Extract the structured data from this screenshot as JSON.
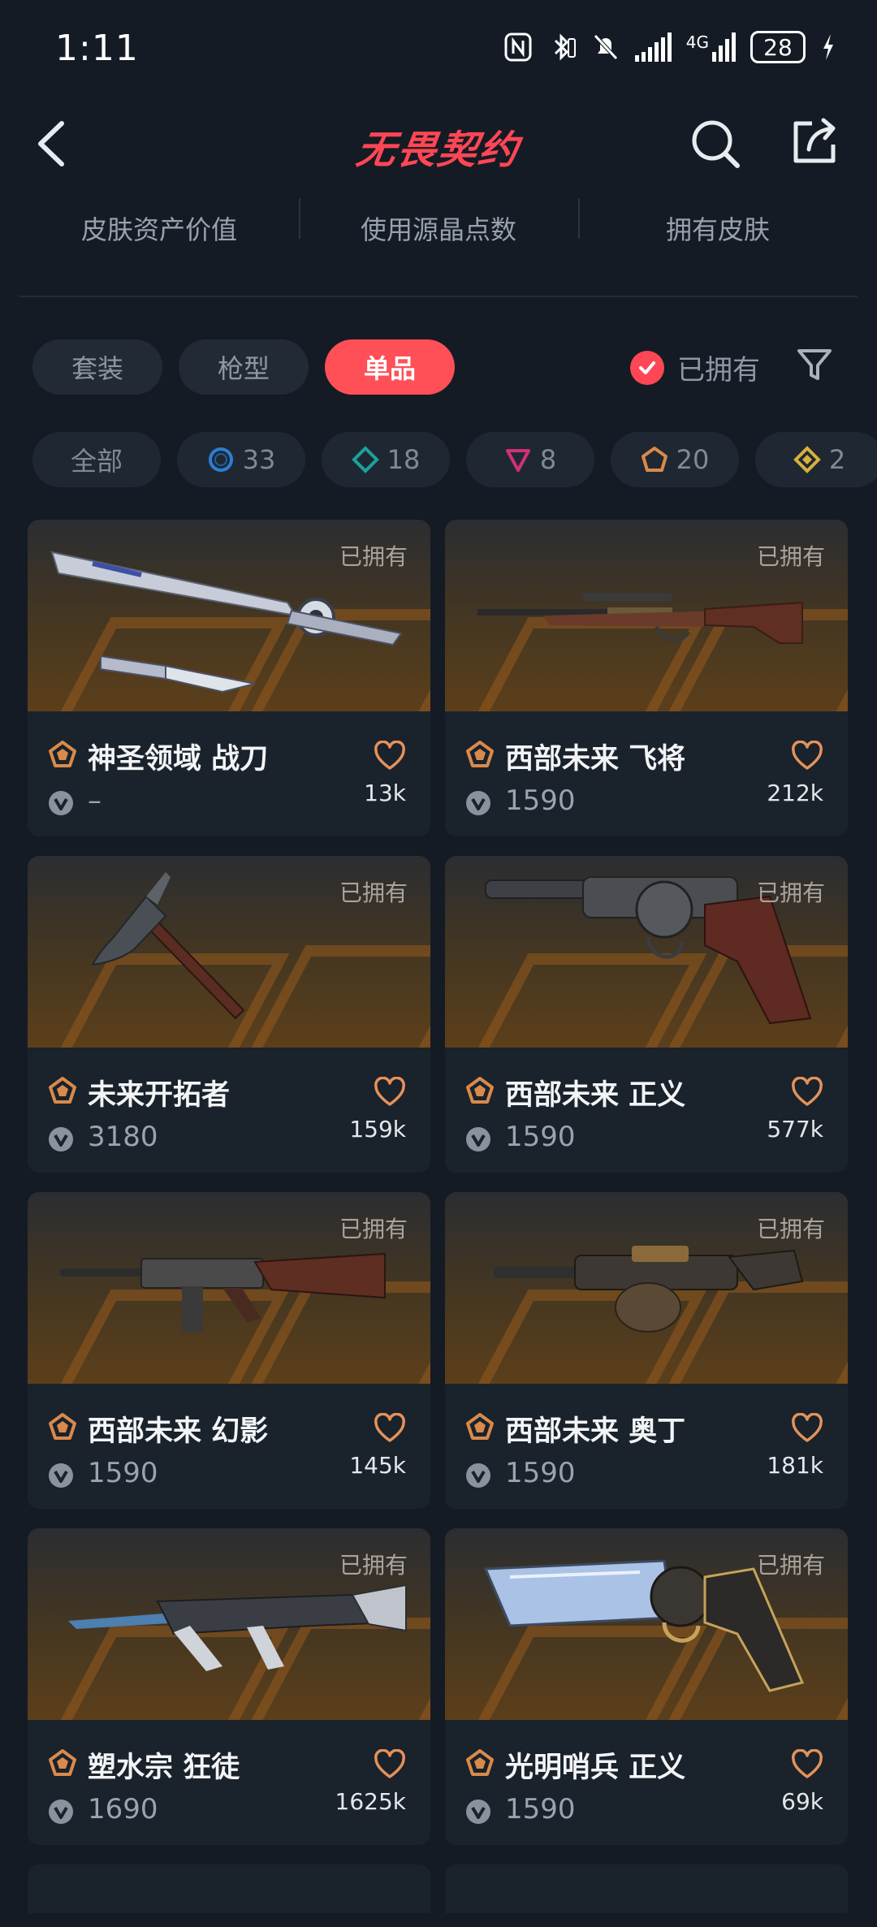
{
  "status_bar": {
    "time": "1:11",
    "network": "4G",
    "battery": "28"
  },
  "header": {
    "logo": "无畏契约",
    "logo_color": "#ff4655"
  },
  "stats": [
    {
      "label": "皮肤资产价值"
    },
    {
      "label": "使用源晶点数"
    },
    {
      "label": "拥有皮肤"
    }
  ],
  "categories": [
    {
      "label": "套装",
      "active": false
    },
    {
      "label": "枪型",
      "active": false
    },
    {
      "label": "单品",
      "active": true
    }
  ],
  "owned_filter": {
    "label": "已拥有",
    "checked": true
  },
  "rarity_filters": [
    {
      "label": "全部",
      "icon": "none"
    },
    {
      "label": "33",
      "icon": "circle-tier-icon",
      "color": "#2b7fd4"
    },
    {
      "label": "18",
      "icon": "diamond-tier-icon",
      "color": "#1aa39a"
    },
    {
      "label": "8",
      "icon": "triangle-tier-icon",
      "color": "#d1307a"
    },
    {
      "label": "20",
      "icon": "pentagon-tier-icon",
      "color": "#d98a4a"
    },
    {
      "label": "2",
      "icon": "rhombus-tier-icon",
      "color": "#d8b03c"
    }
  ],
  "items": [
    {
      "name": "神圣领域 战刀",
      "price": "–",
      "likes": "13k",
      "owned": "已拥有",
      "weapon": "knife"
    },
    {
      "name": "西部未来 飞将",
      "price": "1590",
      "likes": "212k",
      "owned": "已拥有",
      "weapon": "rifle"
    },
    {
      "name": "未来开拓者",
      "price": "3180",
      "likes": "159k",
      "owned": "已拥有",
      "weapon": "axe"
    },
    {
      "name": "西部未来 正义",
      "price": "1590",
      "likes": "577k",
      "owned": "已拥有",
      "weapon": "revolver"
    },
    {
      "name": "西部未来 幻影",
      "price": "1590",
      "likes": "145k",
      "owned": "已拥有",
      "weapon": "phantom"
    },
    {
      "name": "西部未来 奥丁",
      "price": "1590",
      "likes": "181k",
      "owned": "已拥有",
      "weapon": "odin"
    },
    {
      "name": "塑水宗 狂徒",
      "price": "1690",
      "likes": "1625k",
      "owned": "已拥有",
      "weapon": "vandal"
    },
    {
      "name": "光明哨兵 正义",
      "price": "1590",
      "likes": "69k",
      "owned": "已拥有",
      "weapon": "sheriff"
    }
  ],
  "colors": {
    "background": "#141b24",
    "card": "#1a222c",
    "accent": "#ff4f57",
    "tier": "#d98a4a"
  }
}
